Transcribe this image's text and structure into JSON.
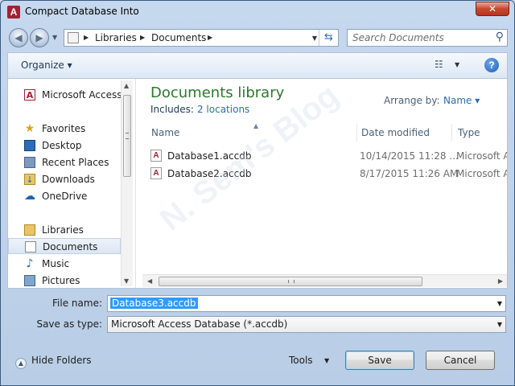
{
  "window": {
    "title": "Compact Database Into",
    "app_icon": "access-icon",
    "close_glyph": "✕"
  },
  "address_bar": {
    "crumbs": [
      "Libraries",
      "Documents"
    ]
  },
  "search": {
    "placeholder": "Search Documents"
  },
  "toolbar": {
    "organize_label": "Organize ▾"
  },
  "nav_pane": {
    "items": [
      {
        "label": "Microsoft Access",
        "icon": "access-icon"
      },
      {
        "label": "Favorites",
        "icon": "star-icon"
      },
      {
        "label": "Desktop",
        "icon": "desktop-icon"
      },
      {
        "label": "Recent Places",
        "icon": "recent-places-icon"
      },
      {
        "label": "Downloads",
        "icon": "downloads-icon"
      },
      {
        "label": "OneDrive",
        "icon": "onedrive-icon"
      },
      {
        "label": "Libraries",
        "icon": "libraries-icon"
      },
      {
        "label": "Documents",
        "icon": "documents-icon",
        "selected": true
      },
      {
        "label": "Music",
        "icon": "music-icon"
      },
      {
        "label": "Pictures",
        "icon": "pictures-icon"
      }
    ]
  },
  "library": {
    "title": "Documents library",
    "includes_label": "Includes:",
    "locations_link": "2 locations",
    "arrange_label": "Arrange by:",
    "arrange_value": "Name ▾"
  },
  "file_list": {
    "columns": [
      "Name",
      "Date modified",
      "Type"
    ],
    "rows": [
      {
        "name": "Database1.accdb",
        "date": "10/14/2015 11:28 ...",
        "type": "Microsoft Acc"
      },
      {
        "name": "Database2.accdb",
        "date": "8/17/2015 11:26 AM",
        "type": "Microsoft Acc"
      }
    ]
  },
  "form": {
    "file_name_label": "File name:",
    "file_name_value": "Database3.accdb",
    "save_type_label": "Save as type:",
    "save_type_value": "Microsoft Access Database (*.accdb)"
  },
  "footer": {
    "hide_folders_label": "Hide Folders",
    "tools_label": "Tools",
    "save_label": "Save",
    "cancel_label": "Cancel"
  },
  "watermark": {
    "text": "N. Sem's Blog"
  },
  "colors": {
    "accent": "#2c6db4",
    "library_title": "#2a7a2a",
    "selection": "#3399ff",
    "access_red": "#a42134"
  }
}
